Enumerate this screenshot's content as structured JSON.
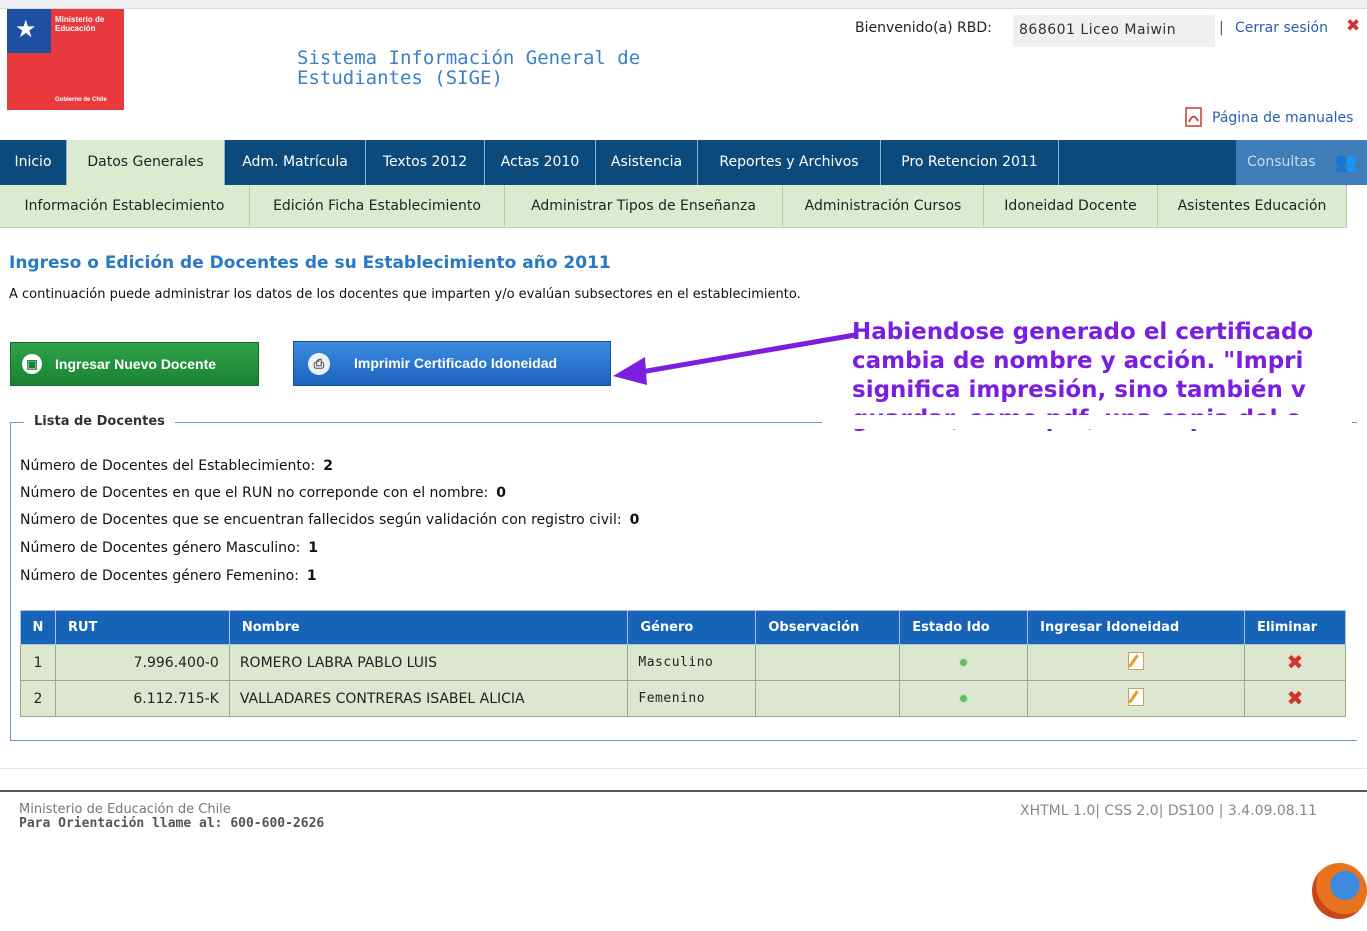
{
  "header": {
    "logo": {
      "line1": "Ministerio de",
      "line2": "Educación",
      "bottom": "Gobierno de Chile"
    },
    "system_title": "Sistema Información General de Estudiantes (SIGE)",
    "welcome": "Bienvenido(a) RBD:",
    "rbd_value": "868601  Liceo Maiwin",
    "separator": "|",
    "logout": "Cerrar sesión",
    "manuals_link": "Página de manuales"
  },
  "nav": {
    "items": [
      "Inicio",
      "Datos Generales",
      "Adm. Matrícula",
      "Textos 2012",
      "Actas 2010",
      "Asistencia",
      "Reportes y Archivos",
      "Pro Retencion 2011"
    ],
    "active": "Datos Generales",
    "consultas": "Consultas"
  },
  "subnav": {
    "items": [
      "Información Establecimiento",
      "Edición Ficha Establecimiento",
      "Administrar Tipos de Enseñanza",
      "Administración Cursos",
      "Idoneidad Docente",
      "Asistentes Educación"
    ]
  },
  "page": {
    "title": "Ingreso o Edición de Docentes de su Establecimiento año 2011",
    "description": "A continuación puede administrar los datos de los docentes que imparten y/o evalúan subsectores en el establecimiento."
  },
  "buttons": {
    "new_teacher": "Ingresar Nuevo Docente",
    "print_certificate": "Imprimir Certificado Idoneidad"
  },
  "annotation": {
    "lines": [
      "Habiendose generado el certificado",
      "cambia de nombre y acción. \"Impri",
      "significa impresión, sino también v",
      "guardar, como pdf, una copia del c"
    ],
    "color": "#7a1fe0"
  },
  "list": {
    "legend": "Lista de Docentes",
    "stats": [
      {
        "label": "Número de Docentes del Establecimiento:",
        "value": "2"
      },
      {
        "label": "Número de Docentes en que el RUN no correponde con el nombre:",
        "value": "0"
      },
      {
        "label": "Número de Docentes que se encuentran fallecidos según validación con registro civil:",
        "value": "0"
      },
      {
        "label": "Número de Docentes género Masculino:",
        "value": "1"
      },
      {
        "label": "Número de Docentes género Femenino:",
        "value": "1"
      }
    ],
    "columns": [
      "N",
      "RUT",
      "Nombre",
      "Género",
      "Observación",
      "Estado Ido",
      "Ingresar Idoneidad",
      "Eliminar"
    ],
    "rows": [
      {
        "n": "1",
        "rut": "7.996.400-0",
        "nombre": "ROMERO LABRA PABLO LUIS",
        "genero": "Masculino",
        "observacion": ""
      },
      {
        "n": "2",
        "rut": "6.112.715-K",
        "nombre": "VALLADARES CONTRERAS ISABEL ALICIA",
        "genero": "Femenino",
        "observacion": ""
      }
    ]
  },
  "footer": {
    "org": "Ministerio de Educación de Chile",
    "phone": "Para Orientación llame al: 600-600-2626",
    "version": "XHTML 1.0| CSS 2.0| DS100 | 3.4.09.08.11"
  },
  "icons": [
    "chile-crest-icon",
    "close-x-icon",
    "pdf-icon",
    "people-icon",
    "save-disk-icon",
    "printer-icon",
    "status-dot-icon",
    "edit-pencil-icon",
    "delete-x-icon",
    "firefox-icon"
  ]
}
